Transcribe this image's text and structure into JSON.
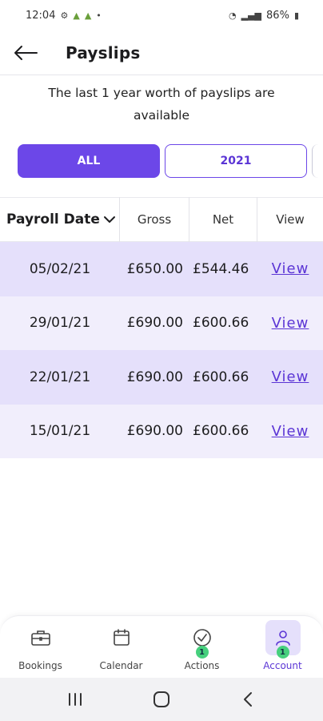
{
  "status_bar": {
    "time": "12:04",
    "battery": "86%"
  },
  "header": {
    "title": "Payslips"
  },
  "info_text": "The last 1 year worth of payslips are available",
  "filters": {
    "all": "ALL",
    "year": "2021",
    "selected": "ALL"
  },
  "table": {
    "headers": {
      "date": "Payroll Date",
      "gross": "Gross",
      "net": "Net",
      "view": "View"
    },
    "rows": [
      {
        "date": "05/02/21",
        "gross": "£650.00",
        "net": "£544.46",
        "view": "View"
      },
      {
        "date": "29/01/21",
        "gross": "£690.00",
        "net": "£600.66",
        "view": "View"
      },
      {
        "date": "22/01/21",
        "gross": "£690.00",
        "net": "£600.66",
        "view": "View"
      },
      {
        "date": "15/01/21",
        "gross": "£690.00",
        "net": "£600.66",
        "view": "View"
      }
    ]
  },
  "bottom_nav": {
    "items": [
      {
        "label": "Bookings",
        "icon": "briefcase-icon"
      },
      {
        "label": "Calendar",
        "icon": "calendar-icon"
      },
      {
        "label": "Actions",
        "icon": "check-circle-icon",
        "badge": "1"
      },
      {
        "label": "Account",
        "icon": "user-icon",
        "badge": "1",
        "active": true
      }
    ]
  },
  "colors": {
    "accent": "#6c47e8",
    "row_dark": "#e5e0fb",
    "row_light": "#f1eefc",
    "badge": "#46d07d"
  }
}
